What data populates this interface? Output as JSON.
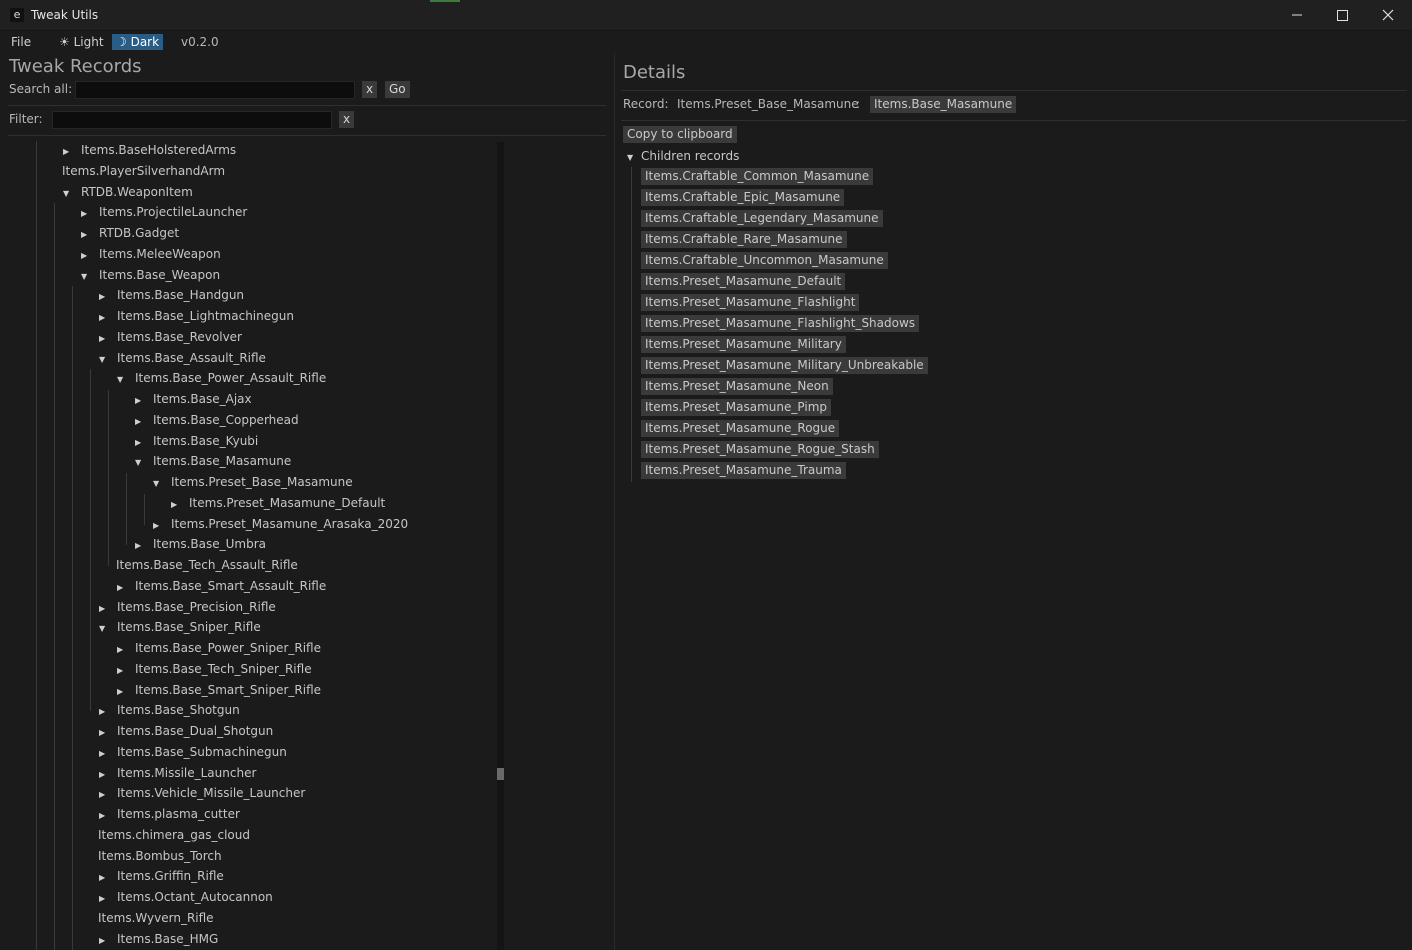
{
  "window": {
    "title": "Tweak Utils",
    "app_icon_glyph": "e"
  },
  "menubar": {
    "file": "File",
    "light": "☀ Light",
    "dark": "☽ Dark",
    "version": "v0.2.0"
  },
  "left": {
    "title": "Tweak Records",
    "search_label": "Search all:",
    "search_value": "",
    "clear_search": "x",
    "go": "Go",
    "filter_label": "Filter:",
    "filter_value": "",
    "clear_filter": "x"
  },
  "tree": {
    "rows": [
      {
        "label": "Items.BaseHolsteredArms",
        "depth": 2,
        "arrow": "right"
      },
      {
        "label": "Items.PlayerSilverhandArm",
        "depth": 1,
        "arrow": "none"
      },
      {
        "label": "RTDB.WeaponItem",
        "depth": 2,
        "arrow": "down"
      },
      {
        "label": "Items.ProjectileLauncher",
        "depth": 3,
        "arrow": "right"
      },
      {
        "label": "RTDB.Gadget",
        "depth": 3,
        "arrow": "right"
      },
      {
        "label": "Items.MeleeWeapon",
        "depth": 3,
        "arrow": "right"
      },
      {
        "label": "Items.Base_Weapon",
        "depth": 3,
        "arrow": "down"
      },
      {
        "label": "Items.Base_Handgun",
        "depth": 4,
        "arrow": "right"
      },
      {
        "label": "Items.Base_Lightmachinegun",
        "depth": 4,
        "arrow": "right"
      },
      {
        "label": "Items.Base_Revolver",
        "depth": 4,
        "arrow": "right"
      },
      {
        "label": "Items.Base_Assault_Rifle",
        "depth": 4,
        "arrow": "down"
      },
      {
        "label": "Items.Base_Power_Assault_Rifle",
        "depth": 5,
        "arrow": "down"
      },
      {
        "label": "Items.Base_Ajax",
        "depth": 6,
        "arrow": "right"
      },
      {
        "label": "Items.Base_Copperhead",
        "depth": 6,
        "arrow": "right"
      },
      {
        "label": "Items.Base_Kyubi",
        "depth": 6,
        "arrow": "right"
      },
      {
        "label": "Items.Base_Masamune",
        "depth": 6,
        "arrow": "down"
      },
      {
        "label": "Items.Preset_Base_Masamune",
        "depth": 7,
        "arrow": "down"
      },
      {
        "label": "Items.Preset_Masamune_Default",
        "depth": 8,
        "arrow": "right"
      },
      {
        "label": "Items.Preset_Masamune_Arasaka_2020",
        "depth": 7,
        "arrow": "right"
      },
      {
        "label": "Items.Base_Umbra",
        "depth": 6,
        "arrow": "right"
      },
      {
        "label": "Items.Base_Tech_Assault_Rifle",
        "depth": 4,
        "arrow": "none"
      },
      {
        "label": "Items.Base_Smart_Assault_Rifle",
        "depth": 5,
        "arrow": "right"
      },
      {
        "label": "Items.Base_Precision_Rifle",
        "depth": 4,
        "arrow": "right"
      },
      {
        "label": "Items.Base_Sniper_Rifle",
        "depth": 4,
        "arrow": "down"
      },
      {
        "label": "Items.Base_Power_Sniper_Rifle",
        "depth": 5,
        "arrow": "right"
      },
      {
        "label": "Items.Base_Tech_Sniper_Rifle",
        "depth": 5,
        "arrow": "right"
      },
      {
        "label": "Items.Base_Smart_Sniper_Rifle",
        "depth": 5,
        "arrow": "right"
      },
      {
        "label": "Items.Base_Shotgun",
        "depth": 4,
        "arrow": "right"
      },
      {
        "label": "Items.Base_Dual_Shotgun",
        "depth": 4,
        "arrow": "right"
      },
      {
        "label": "Items.Base_Submachinegun",
        "depth": 4,
        "arrow": "right"
      },
      {
        "label": "Items.Missile_Launcher",
        "depth": 4,
        "arrow": "right"
      },
      {
        "label": "Items.Vehicle_Missile_Launcher",
        "depth": 4,
        "arrow": "right"
      },
      {
        "label": "Items.plasma_cutter",
        "depth": 4,
        "arrow": "right"
      },
      {
        "label": "Items.chimera_gas_cloud",
        "depth": 3,
        "arrow": "none"
      },
      {
        "label": "Items.Bombus_Torch",
        "depth": 3,
        "arrow": "none"
      },
      {
        "label": "Items.Griffin_Rifle",
        "depth": 4,
        "arrow": "right"
      },
      {
        "label": "Items.Octant_Autocannon",
        "depth": 4,
        "arrow": "right"
      },
      {
        "label": "Items.Wyvern_Rifle",
        "depth": 3,
        "arrow": "none"
      },
      {
        "label": "Items.Base_HMG",
        "depth": 4,
        "arrow": "right"
      }
    ]
  },
  "details": {
    "title": "Details",
    "record_label": "Record:",
    "record_value": "Items.Preset_Base_Masamune",
    "separator": ":",
    "parent_record": "Items.Base_Masamune",
    "copy_button": "Copy to clipboard",
    "children_header": "Children records",
    "children": [
      "Items.Craftable_Common_Masamune",
      "Items.Craftable_Epic_Masamune",
      "Items.Craftable_Legendary_Masamune",
      "Items.Craftable_Rare_Masamune",
      "Items.Craftable_Uncommon_Masamune",
      "Items.Preset_Masamune_Default",
      "Items.Preset_Masamune_Flashlight",
      "Items.Preset_Masamune_Flashlight_Shadows",
      "Items.Preset_Masamune_Military",
      "Items.Preset_Masamune_Military_Unbreakable",
      "Items.Preset_Masamune_Neon",
      "Items.Preset_Masamune_Pimp",
      "Items.Preset_Masamune_Rogue",
      "Items.Preset_Masamune_Rogue_Stash",
      "Items.Preset_Masamune_Trauma"
    ]
  },
  "icons": {
    "minimize": "minimize-icon",
    "maximize": "maximize-icon",
    "close": "close-icon",
    "expand_arrow": "triangle-right-icon",
    "collapse_arrow": "triangle-down-icon"
  },
  "colors": {
    "background": "#1b1b1b",
    "titlebar": "#202020",
    "selected_theme": "#2a5d86",
    "chip": "#3a3a3a",
    "input": "#0d0d0d"
  }
}
